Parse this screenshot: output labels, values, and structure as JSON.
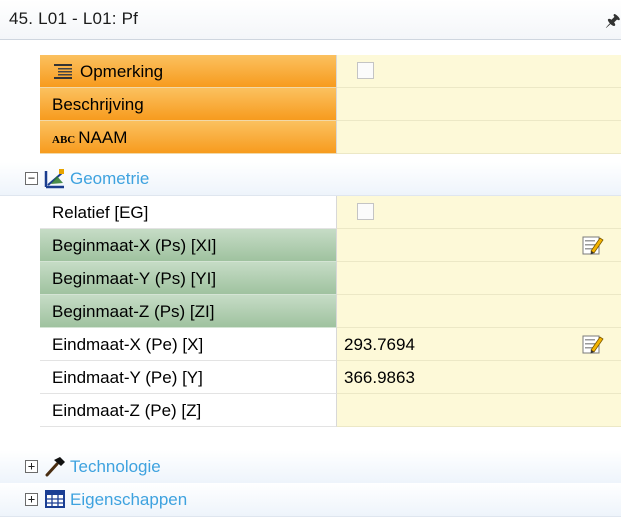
{
  "window": {
    "title": "45. L01 - L01: Pf",
    "pin_icon": "pin-icon"
  },
  "rows_top": [
    {
      "name": "Opmerking",
      "icon": "list-lines-icon",
      "value": "",
      "control": "checkbox"
    },
    {
      "name": "Beschrijving",
      "value": ""
    },
    {
      "name": "NAAM",
      "icon_text": "ABC",
      "value": ""
    }
  ],
  "categories": {
    "geometrie": "Geometrie",
    "technologie": "Technologie",
    "eigenschappen": "Eigenschappen"
  },
  "geometry_rows": [
    {
      "name": "Relatief [EG]",
      "value": "",
      "control": "checkbox"
    },
    {
      "name": "Beginmaat-X (Ps) [XI]",
      "value": "",
      "control": "edit-button"
    },
    {
      "name": "Beginmaat-Y (Ps) [YI]",
      "value": ""
    },
    {
      "name": "Beginmaat-Z (Ps) [ZI]",
      "value": ""
    },
    {
      "name": "Eindmaat-X (Pe) [X]",
      "value": "293.7694",
      "control": "edit-button"
    },
    {
      "name": "Eindmaat-Y (Pe) [Y]",
      "value": "366.9863"
    },
    {
      "name": "Eindmaat-Z (Pe) [Z]",
      "value": ""
    }
  ],
  "colors": {
    "orange": "#f79b1e",
    "green": "#9fc29f",
    "value_bg": "#fdf9d8",
    "category_text": "#3ea2df"
  }
}
